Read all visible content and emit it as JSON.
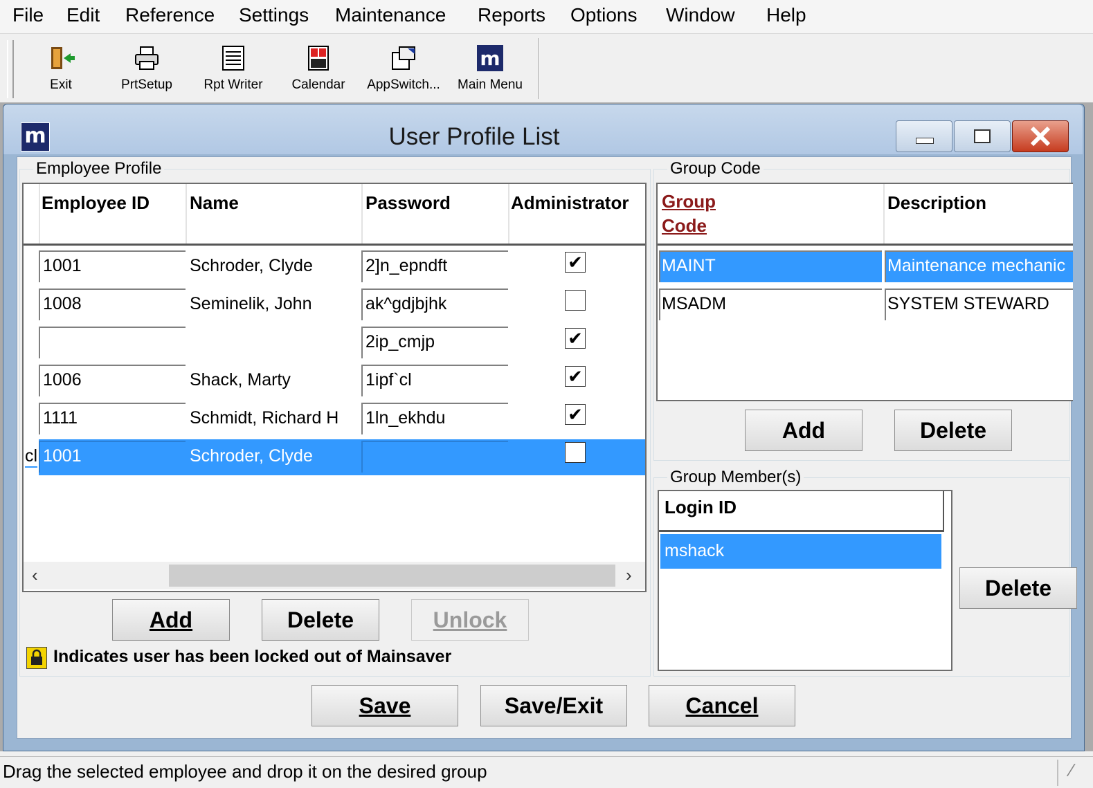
{
  "menu": [
    "File",
    "Edit",
    "Reference",
    "Settings",
    "Maintenance",
    "Reports",
    "Options",
    "Window",
    "Help"
  ],
  "toolbar": {
    "exit": "Exit",
    "prtsetup": "PrtSetup",
    "rptwriter": "Rpt Writer",
    "calendar": "Calendar",
    "appswitch": "AppSwitch...",
    "mainmenu": "Main Menu"
  },
  "window": {
    "title": "User Profile List",
    "logo": "m"
  },
  "employee_profile": {
    "label": "Employee Profile",
    "headers": {
      "id": "Employee ID",
      "name": "Name",
      "password": "Password",
      "admin": "Administrator"
    },
    "rows": [
      {
        "id": "1001",
        "name": "Schroder, Clyde",
        "password": "2]n_epndft",
        "admin": true
      },
      {
        "id": "1008",
        "name": "Seminelik, John",
        "password": "ak^gdjbjhk",
        "admin": false
      },
      {
        "id": "",
        "name": "",
        "password": "2ip_cmjp",
        "admin": true
      },
      {
        "id": "1006",
        "name": "Shack, Marty",
        "password": "1ipf`cl",
        "admin": true
      },
      {
        "id": "1111",
        "name": "Schmidt, Richard H",
        "password": "1ln_ekhdu",
        "admin": true
      },
      {
        "id": "1001",
        "name": "Schroder, Clyde",
        "password": "",
        "admin": false,
        "selected": true,
        "row_marker": "cl"
      }
    ],
    "add": "Add",
    "delete": "Delete",
    "unlock": "Unlock",
    "lock_note": "Indicates user has been locked out of Mainsaver"
  },
  "group_code": {
    "label": "Group Code",
    "headers": {
      "code_line1": "Group",
      "code_line2": "Code",
      "description": "Description"
    },
    "rows": [
      {
        "code": "MAINT",
        "description": "Maintenance mechanic",
        "selected": true
      },
      {
        "code": "MSADM",
        "description": "SYSTEM STEWARD",
        "selected": false
      }
    ],
    "add": "Add",
    "delete": "Delete"
  },
  "group_members": {
    "label": "Group Member(s)",
    "header": "Login ID",
    "rows": [
      "mshack"
    ],
    "delete": "Delete"
  },
  "footer": {
    "save": "Save",
    "save_exit": "Save/Exit",
    "cancel": "Cancel"
  },
  "status": "Drag the selected employee and drop it on the desired group",
  "colors": {
    "selection": "#3399ff",
    "titlebar": "#b9cfe8",
    "header_link": "#8b1a1a"
  }
}
